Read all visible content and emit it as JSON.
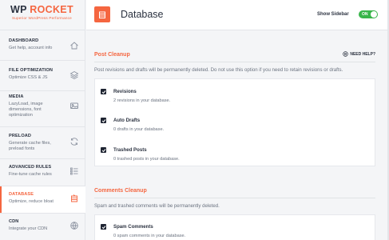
{
  "brand": {
    "name_prefix": "WP",
    "name_suffix": "ROCKET",
    "tagline": "Superior WordPress Performance"
  },
  "sidebar": {
    "items": [
      {
        "title": "DASHBOARD",
        "sub": "Get help, account info",
        "icon": "home-icon",
        "active": false
      },
      {
        "title": "FILE OPTIMIZATION",
        "sub": "Optimize CSS & JS",
        "icon": "layers-icon",
        "active": false
      },
      {
        "title": "MEDIA",
        "sub": "LazyLoad, image dimensions, font optimization",
        "icon": "image-icon",
        "active": false
      },
      {
        "title": "PRELOAD",
        "sub": "Generate cache files, preload fonts",
        "icon": "refresh-icon",
        "active": false
      },
      {
        "title": "ADVANCED RULES",
        "sub": "Fine-tune cache rules",
        "icon": "list-icon",
        "active": false
      },
      {
        "title": "DATABASE",
        "sub": "Optimize, reduce bloat",
        "icon": "database-icon",
        "active": true
      },
      {
        "title": "CDN",
        "sub": "Integrate your CDN",
        "icon": "cdn-icon",
        "active": false
      }
    ]
  },
  "header": {
    "title": "Database",
    "toggle_label": "Show Sidebar",
    "toggle_state": "ON"
  },
  "post_cleanup": {
    "title": "Post Cleanup",
    "help": "NEED HELP?",
    "description": "Post revisions and drafts will be permanently deleted. Do not use this option if you need to retain revisions or drafts.",
    "options": [
      {
        "label": "Revisions",
        "count": "2 revisions in your database.",
        "checked": true
      },
      {
        "label": "Auto Drafts",
        "count": "0 drafts in your database.",
        "checked": true
      },
      {
        "label": "Trashed Posts",
        "count": "0 trashed posts in your database.",
        "checked": true
      }
    ]
  },
  "comments_cleanup": {
    "title": "Comments Cleanup",
    "description": "Spam and trashed comments will be permanently deleted.",
    "options": [
      {
        "label": "Spam Comments",
        "count": "0 spam comments in your database.",
        "checked": true
      }
    ]
  },
  "colors": {
    "accent": "#f56640",
    "toggle_on": "#39b54a",
    "text": "#2b3240",
    "muted": "#6b7380"
  }
}
